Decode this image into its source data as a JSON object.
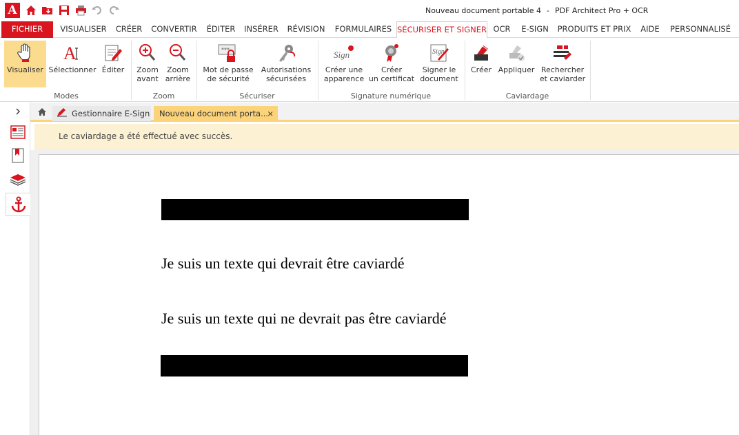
{
  "window": {
    "doc_title": "Nouveau document portable 4",
    "separator": "-",
    "app_name": "PDF Architect Pro + OCR",
    "logo_letter": "A"
  },
  "quick_access": [
    "home-icon",
    "open-icon",
    "save-icon",
    "print-icon",
    "undo-icon",
    "redo-icon"
  ],
  "menu": {
    "fichier": "FICHIER",
    "tabs": [
      "VISUALISER",
      "CRÉER",
      "CONVERTIR",
      "ÉDITER",
      "INSÉRER",
      "RÉVISION",
      "FORMULAIRES",
      "SÉCURISER ET SIGNER",
      "OCR",
      "E-SIGN",
      "PRODUITS ET PRIX",
      "AIDE",
      "PERSONNALISÉ"
    ],
    "active_tab": "SÉCURISER ET SIGNER"
  },
  "ribbon": {
    "modes": {
      "label": "Modes",
      "visualiser": "Visualiser",
      "selectionner": "Sélectionner",
      "editer": "Éditer"
    },
    "zoom": {
      "label": "Zoom",
      "avant_1": "Zoom",
      "avant_2": "avant",
      "arriere_1": "Zoom",
      "arriere_2": "arrière"
    },
    "securiser": {
      "label": "Sécuriser",
      "mdp_1": "Mot de passe",
      "mdp_2": "de sécurité",
      "auto_1": "Autorisations",
      "auto_2": "sécurisées"
    },
    "signature": {
      "label": "Signature numérique",
      "apparence_1": "Créer une",
      "apparence_2": "apparence",
      "certificat_1": "Créer",
      "certificat_2": "un certificat",
      "signer_1": "Signer le",
      "signer_2": "document"
    },
    "caviardage": {
      "label": "Caviardage",
      "creer": "Créer",
      "appliquer": "Appliquer",
      "rech_1": "Rechercher",
      "rech_2": "et caviarder"
    }
  },
  "doc_tabs": {
    "esign": "Gestionnaire E-Sign",
    "current": "Nouveau document porta...",
    "close": "×"
  },
  "notification": "Le caviardage a été effectué avec succès.",
  "document": {
    "line1": "Je suis un texte qui devrait être caviardé",
    "line2": "Je suis un texte qui ne devrait pas être caviardé"
  },
  "colors": {
    "accent": "#d9161f",
    "selected": "#fbdc8f",
    "notification_bg": "#fcf1d2",
    "tab_underline": "#fbd37a"
  }
}
